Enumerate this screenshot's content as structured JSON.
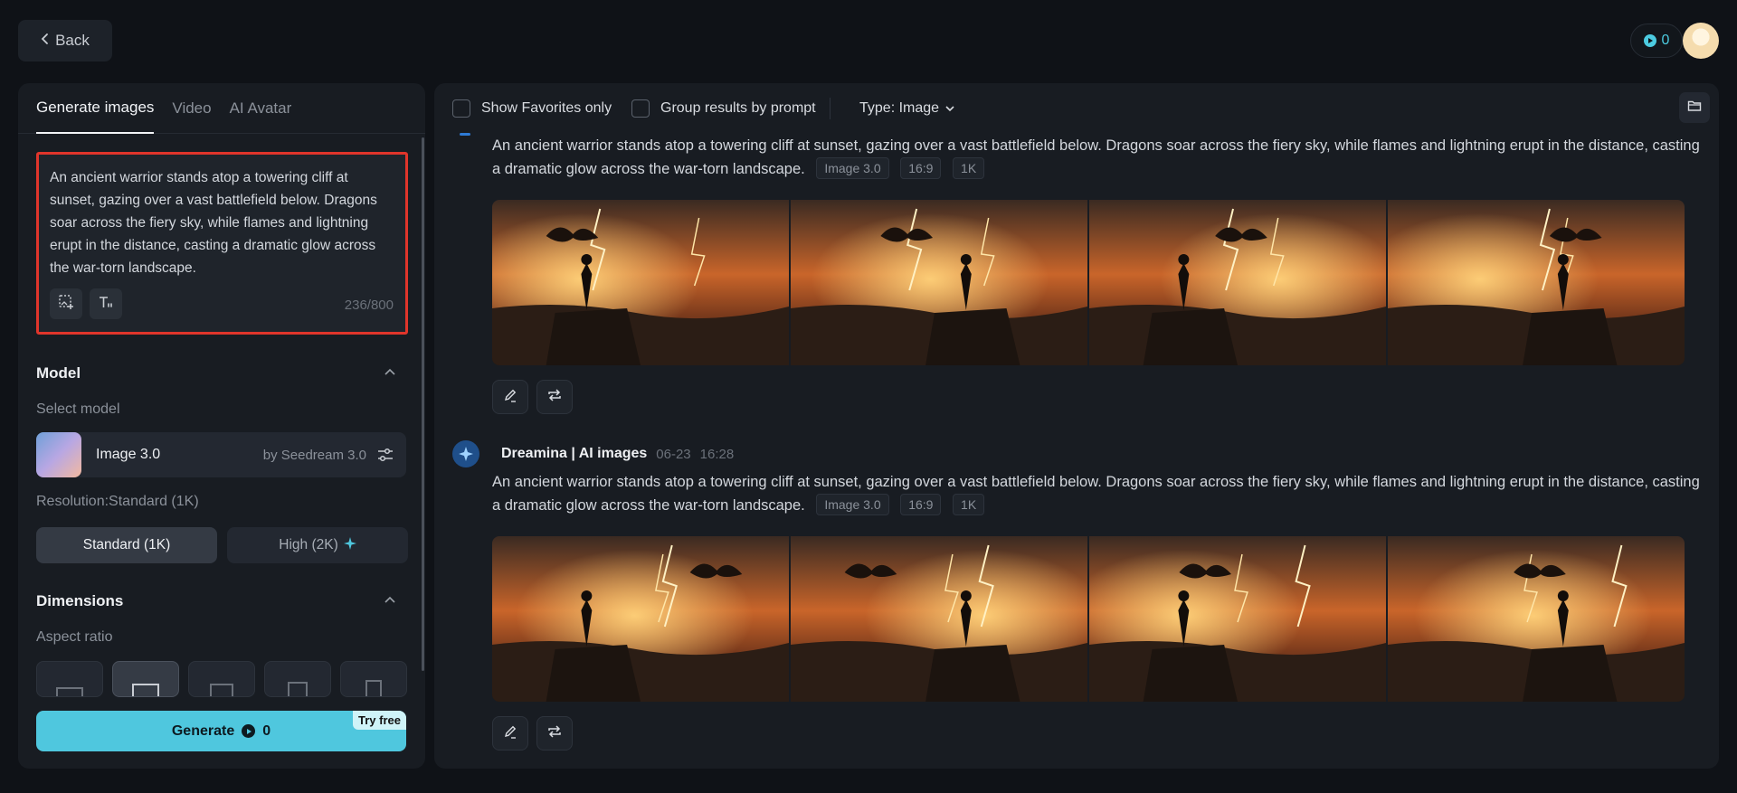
{
  "topbar": {
    "back_label": "Back",
    "credits": "0"
  },
  "left": {
    "tabs": [
      {
        "label": "Generate images",
        "active": true
      },
      {
        "label": "Video",
        "active": false
      },
      {
        "label": "AI Avatar",
        "active": false
      }
    ],
    "prompt": {
      "text": "An ancient warrior stands atop a towering cliff at sunset, gazing over a vast battlefield below. Dragons soar across the fiery sky, while flames and lightning erupt in the distance, casting a dramatic glow across the war-torn landscape.",
      "counter": "236/800"
    },
    "model_section": {
      "title": "Model",
      "select_label": "Select model",
      "model_name": "Image 3.0",
      "model_by": "by Seedream 3.0",
      "resolution_label": "Resolution:Standard (1K)",
      "res_standard": "Standard (1K)",
      "res_high": "High (2K)"
    },
    "dimensions_section": {
      "title": "Dimensions",
      "aspect_label": "Aspect ratio"
    },
    "generate": {
      "label": "Generate",
      "cost": "0",
      "badge": "Try free"
    }
  },
  "main": {
    "filters": {
      "favorites": "Show Favorites only",
      "group": "Group results by prompt",
      "type": "Type: Image"
    },
    "results": [
      {
        "prompt": "An ancient warrior stands atop a towering cliff at sunset, gazing over a vast battlefield below. Dragons soar across the fiery sky, while flames and lightning erupt in the distance, casting a dramatic glow across the war-torn landscape.",
        "tags": [
          "Image 3.0",
          "16:9",
          "1K"
        ]
      },
      {
        "author": "Dreamina | AI images",
        "date": "06-23",
        "time": "16:28",
        "prompt": "An ancient warrior stands atop a towering cliff at sunset, gazing over a vast battlefield below. Dragons soar across the fiery sky, while flames and lightning erupt in the distance, casting a dramatic glow across the war-torn landscape.",
        "tags": [
          "Image 3.0",
          "16:9",
          "1K"
        ]
      }
    ]
  },
  "colors": {
    "accent": "#4fc7de",
    "highlight_border": "#e0352b",
    "background": "#0f1217",
    "panel": "#181c22"
  }
}
